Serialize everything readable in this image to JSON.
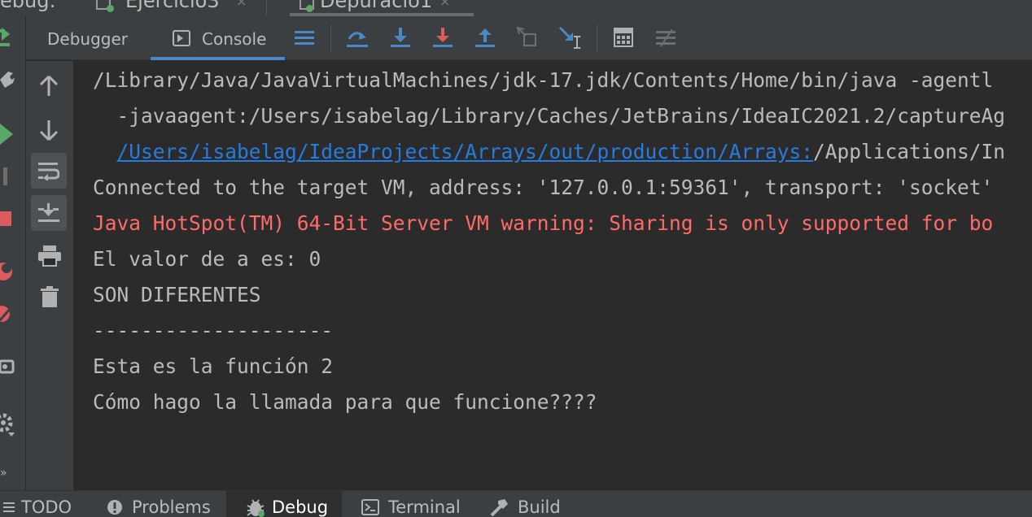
{
  "run_tabs": [
    {
      "label": "ebug:"
    },
    {
      "label": "Ejercicio3",
      "close": "×"
    },
    {
      "label": "Depuracio1",
      "close": "×"
    }
  ],
  "toolbar": {
    "tabs": [
      {
        "label": "Debugger"
      },
      {
        "label": "Console",
        "active": true
      }
    ],
    "icons": [
      "lines-icon",
      "step-over-icon",
      "step-into-icon",
      "force-step-into-icon",
      "step-out-icon",
      "drop-frame-icon",
      "run-to-cursor-icon",
      "evaluate-expression-icon",
      "trace-icon"
    ]
  },
  "console": {
    "lines": [
      {
        "text": "/Library/Java/JavaVirtualMachines/jdk-17.jdk/Contents/Home/bin/java -agentl",
        "type": "normal"
      },
      {
        "text": "  -javaagent:/Users/isabelag/Library/Caches/JetBrains/IdeaIC2021.2/captureAg",
        "type": "normal"
      },
      {
        "link": "/Users/isabelag/IdeaProjects/Arrays/out/production/Arrays:",
        "rest": "/Applications/In"
      },
      {
        "text": "Connected to the target VM, address: '127.0.0.1:59361', transport: 'socket'",
        "type": "normal"
      },
      {
        "text": "Java HotSpot(TM) 64-Bit Server VM warning: Sharing is only supported for bo",
        "type": "error"
      },
      {
        "text": "El valor de a es: 0",
        "type": "normal"
      },
      {
        "text": "SON DIFERENTES",
        "type": "normal"
      },
      {
        "text": "--------------------",
        "type": "normal"
      },
      {
        "text": "Esta es la función 2",
        "type": "normal"
      },
      {
        "text": "Cómo hago la llamada para que funcione????",
        "type": "normal"
      }
    ]
  },
  "bottom_bar": {
    "tabs": [
      {
        "label": "TODO",
        "icon": "list-icon"
      },
      {
        "label": "Problems",
        "icon": "problems-icon"
      },
      {
        "label": "Debug",
        "icon": "bug-icon",
        "active": true
      },
      {
        "label": "Terminal",
        "icon": "terminal-icon"
      },
      {
        "label": "Build",
        "icon": "hammer-icon"
      }
    ]
  },
  "colors": {
    "background": "#2b2b2b",
    "panel": "#3c3f41",
    "text": "#bbbbbb",
    "error": "#ff6b68",
    "link": "#287bde",
    "accent": "#4a88c7",
    "run_green": "#59a869",
    "stop_red": "#db5c5c"
  }
}
